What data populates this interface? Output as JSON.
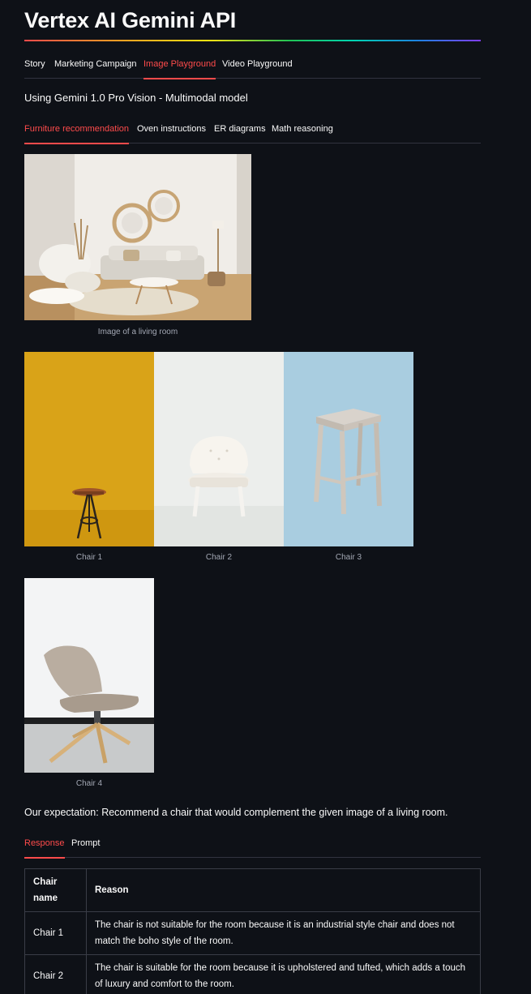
{
  "app": {
    "title": "Vertex AI Gemini API"
  },
  "main_tabs": [
    {
      "label": "Story",
      "active": false
    },
    {
      "label": "Marketing Campaign",
      "active": false
    },
    {
      "label": "Image Playground",
      "active": true
    },
    {
      "label": "Video Playground",
      "active": false
    }
  ],
  "subtitle": "Using Gemini 1.0 Pro Vision - Multimodal model",
  "sub_tabs": [
    {
      "label": "Furniture recommendation",
      "active": true
    },
    {
      "label": "Oven instructions",
      "active": false
    },
    {
      "label": "ER diagrams",
      "active": false
    },
    {
      "label": "Math reasoning",
      "active": false
    }
  ],
  "room_image": {
    "caption": "Image of a living room"
  },
  "chairs": [
    {
      "caption": "Chair 1",
      "background": "#d9a318"
    },
    {
      "caption": "Chair 2",
      "background": "#eceeec"
    },
    {
      "caption": "Chair 3",
      "background": "#a9cde0"
    },
    {
      "caption": "Chair 4",
      "background": "#f3f4f5"
    }
  ],
  "expectation": "Our expectation: Recommend a chair that would complement the given image of a living room.",
  "result_tabs": [
    {
      "label": "Response",
      "active": true
    },
    {
      "label": "Prompt",
      "active": false
    }
  ],
  "response_table": {
    "headers": [
      "Chair name",
      "Reason"
    ],
    "rows": [
      [
        "Chair 1",
        "The chair is not suitable for the room because it is an industrial style chair and does not match the boho style of the room."
      ],
      [
        "Chair 2",
        "The chair is suitable for the room because it is upholstered and tufted, which adds a touch of luxury and comfort to the room."
      ]
    ]
  },
  "colors": {
    "background": "#0e1117",
    "accent": "#ff4b4b",
    "caption": "#a3a8b4",
    "border": "#3a3d47"
  }
}
